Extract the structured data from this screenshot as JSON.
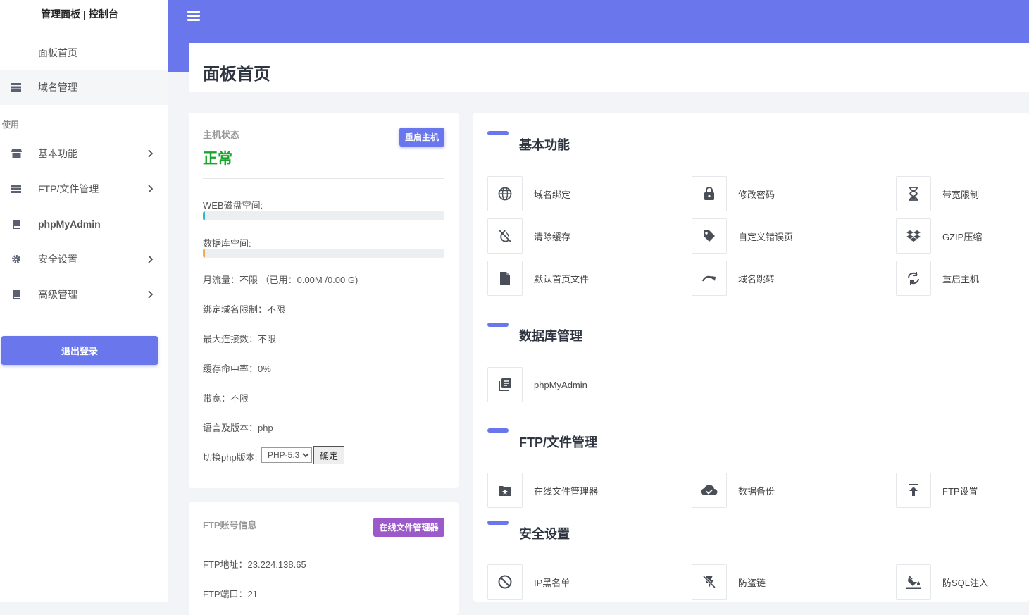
{
  "sidebar": {
    "brand": "管理面板 | 控制台",
    "items": [
      {
        "label": "面板首页",
        "icon": "home-icon"
      },
      {
        "label": "域名管理",
        "icon": "server-icon"
      },
      {
        "label": "基本功能",
        "icon": "store-icon"
      },
      {
        "label": "FTP/文件管理",
        "icon": "server-icon"
      },
      {
        "label": "phpMyAdmin",
        "icon": "book-icon"
      },
      {
        "label": "安全设置",
        "icon": "gear-icon"
      },
      {
        "label": "高级管理",
        "icon": "book-icon"
      }
    ],
    "section_label": "使用",
    "logout_label": "退出登录"
  },
  "header": {
    "title": "面板首页"
  },
  "status": {
    "label": "主机状态",
    "value": "正常",
    "restart_label": "重启主机",
    "web_disk_label": "WEB磁盘空间:",
    "web_disk_usage": 0.01,
    "db_space_label": "数据库空间:",
    "db_space_usage": 0.01,
    "traffic": "月流量：不限 （已用：0.00M /0.00 G)",
    "domain_limit": "绑定域名限制：不限",
    "max_conn": "最大连接数：不限",
    "cache_hit": "缓存命中率：0%",
    "bandwidth": "带宽：不限",
    "language": "语言及版本：php",
    "php_switch_label": "切换php版本:",
    "php_version": "PHP-5.3",
    "confirm_label": "确定"
  },
  "ftp": {
    "label": "FTP账号信息",
    "file_manager_label": "在线文件管理器",
    "address": "FTP地址：23.224.138.65",
    "port": "FTP端口：21"
  },
  "sections": {
    "basic": {
      "title": "基本功能",
      "items": [
        "域名绑定",
        "修改密码",
        "带宽限制",
        "清除缓存",
        "自定义错误页",
        "GZIP压缩",
        "默认首页文件",
        "域名跳转",
        "重启主机"
      ]
    },
    "db": {
      "title": "数据库管理",
      "items": [
        "phpMyAdmin"
      ]
    },
    "ftp": {
      "title": "FTP/文件管理",
      "items": [
        "在线文件管理器",
        "数据备份",
        "FTP设置"
      ]
    },
    "security": {
      "title": "安全设置",
      "items": [
        "IP黑名单",
        "防盗链",
        "防SQL注入"
      ]
    }
  },
  "colors": {
    "accent": "#6a77ec",
    "ok": "#17a52a",
    "purple": "#9b59c9",
    "disk_bar": "#31b7d6",
    "db_bar": "#f0ad4e"
  }
}
